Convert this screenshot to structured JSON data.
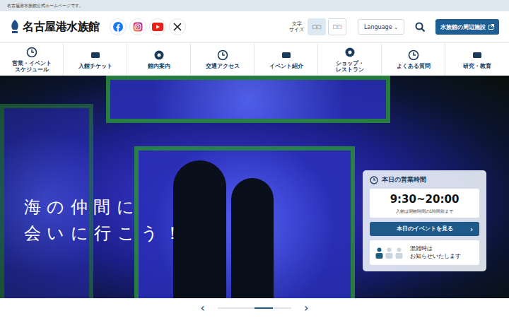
{
  "top_bar": {
    "text": "名古屋港水族館公式ホームページです。"
  },
  "logo": {
    "text": "名古屋港水族館"
  },
  "font_size": {
    "label": "文字\nサイズ",
    "options": [
      {
        "label": "□□",
        "selected": true
      },
      {
        "label": "□□",
        "selected": false
      }
    ]
  },
  "language": {
    "label": "Language",
    "caret": "⌄"
  },
  "nearby_button": {
    "label": "水族館の周辺施設"
  },
  "nav": [
    {
      "label": "営業・イベント\nスケジュール"
    },
    {
      "label": "入館チケット"
    },
    {
      "label": "館内案内"
    },
    {
      "label": "交通アクセス"
    },
    {
      "label": "イベント紹介"
    },
    {
      "label": "ショップ・\nレストラン"
    },
    {
      "label": "よくある質問"
    },
    {
      "label": "研究・教育"
    }
  ],
  "hero": {
    "headline": [
      "海の仲間に",
      "会いに行こう！"
    ]
  },
  "hours_card": {
    "title": "本日の営業時間",
    "hours": "9:30~20:00",
    "note": "入館は閉館時間の1時間前まで",
    "button": "本日のイベントを見る",
    "button_icon": "›",
    "crowd": {
      "text": "混雑時は\nお知らせいたします",
      "filled": 1,
      "total": 3
    }
  },
  "carousel": {
    "prev": "‹",
    "next": "›",
    "slide_count": 4,
    "current_slide": 3
  }
}
